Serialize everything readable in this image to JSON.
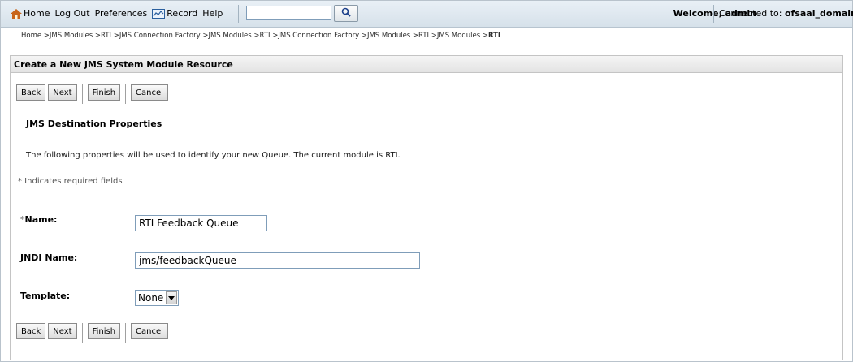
{
  "toolbar": {
    "home": "Home",
    "logout": "Log Out",
    "preferences": "Preferences",
    "record": "Record",
    "help": "Help",
    "search_value": "",
    "welcome": "Welcome, admin",
    "connected_label": "Connected to:",
    "domain": "ofsaai_domain"
  },
  "breadcrumb": {
    "path": "Home >JMS Modules >RTI >JMS Connection Factory >JMS Modules >RTI >JMS Connection Factory >JMS Modules >RTI >JMS Modules >",
    "current": "RTI"
  },
  "page": {
    "title": "Create a New JMS System Module Resource",
    "section_title": "JMS Destination Properties",
    "description": "The following properties will be used to identify your new Queue. The current module is RTI.",
    "required_note": "* Indicates required fields"
  },
  "buttons": {
    "back": "Back",
    "next": "Next",
    "finish": "Finish",
    "cancel": "Cancel"
  },
  "form": {
    "name_star": "*",
    "name_label": "Name:",
    "name_value": "RTI Feedback Queue",
    "jndi_label": "JNDI Name:",
    "jndi_value": "jms/feedbackQueue",
    "template_label": "Template:",
    "template_value": "None"
  },
  "icons": [
    "home-icon",
    "record-icon",
    "search-icon",
    "dropdown-arrow-icon"
  ]
}
